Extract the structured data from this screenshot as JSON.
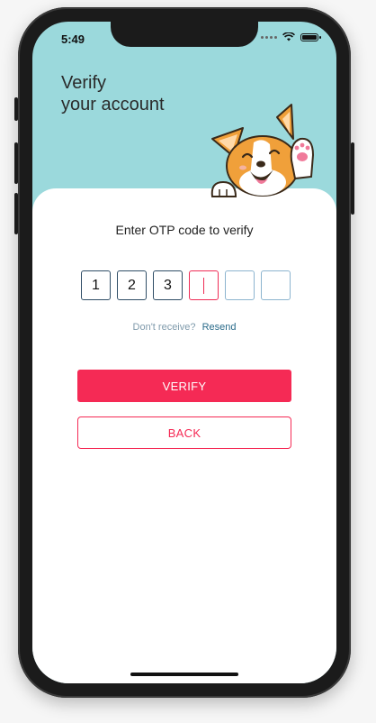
{
  "status_bar": {
    "time": "5:49",
    "icons": [
      "signal-dots-icon",
      "wifi-icon",
      "battery-icon"
    ]
  },
  "header": {
    "title_line1": "Verify",
    "title_line2": "your account",
    "background_color": "#9bd9dc",
    "illustration": "corgi-waving-icon"
  },
  "otp": {
    "prompt": "Enter OTP code to verify",
    "digits": [
      "1",
      "2",
      "3",
      "",
      "",
      ""
    ],
    "active_index": 3
  },
  "resend": {
    "question": "Don't receive?",
    "link_label": "Resend"
  },
  "actions": {
    "verify_label": "VERIFY",
    "back_label": "BACK",
    "accent_color": "#f52a55"
  }
}
